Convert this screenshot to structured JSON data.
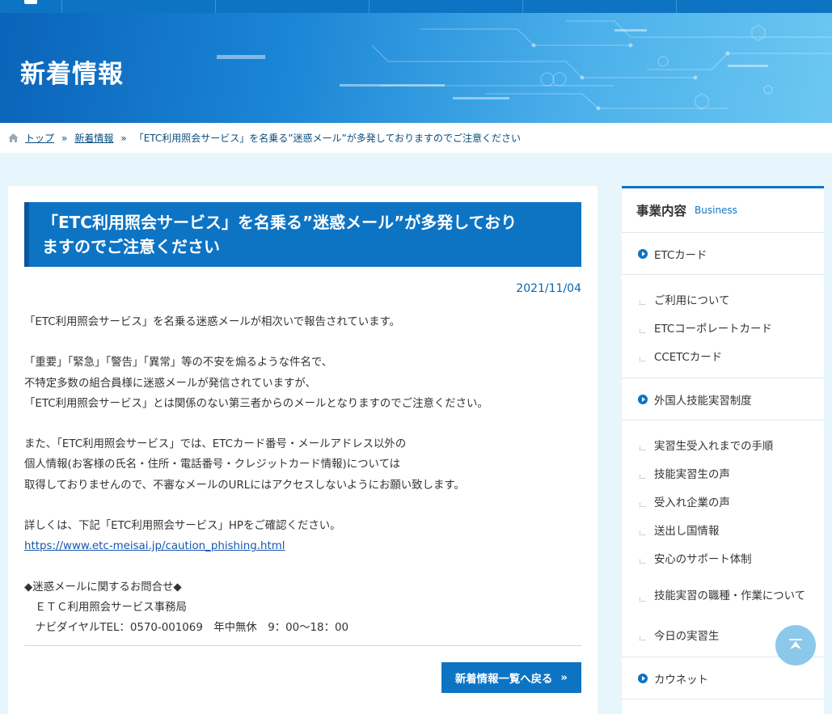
{
  "hero": {
    "title": "新着情報"
  },
  "breadcrumb": {
    "items": [
      "トップ",
      "新着情報"
    ],
    "separator": "»",
    "current": "「ETC利用照会サービス」を名乗る”迷惑メール”が多発しておりますのでご注意ください"
  },
  "article": {
    "title_line1": "「ETC利用照会サービス」を名乗る”迷惑メール”が多発しており",
    "title_line2": "ますのでご注意ください",
    "date": "2021/11/04",
    "lines": [
      "「ETC利用照会サービス」を名乗る迷惑メールが相次いで報告されています。",
      "「重要」「緊急」「警告」「異常」等の不安を煽るような件名で、",
      "不特定多数の組合員様に迷惑メールが発信されていますが、",
      "「ETC利用照会サービス」とは関係のない第三者からのメールとなりますのでご注意ください。",
      "また、「ETC利用照会サービス」では、ETCカード番号・メールアドレス以外の",
      "個人情報(お客様の氏名・住所・電話番号・クレジットカード情報)については",
      "取得しておりませんので、不審なメールのURLにはアクセスしないようにお願い致します。",
      "詳しくは、下記「ETC利用照会サービス」HPをご確認ください。",
      "https://www.etc-meisai.jp/caution_phishing.html",
      "◆迷惑メールに関するお問合せ◆",
      "　ＥＴＣ利用照会サービス事務局",
      "　ナビダイヤルTEL：0570-001069　年中無休　9：00～18：00"
    ],
    "back_label": "新着情報一覧へ戻る",
    "back_arrow": "»"
  },
  "sidebar": {
    "heading": "事業内容",
    "heading_en": "Business",
    "etc_card": "ETCカード",
    "etc_sub": [
      "ご利用について",
      "ETCコーポレートカード",
      "CCETCカード"
    ],
    "trainee": "外国人技能実習制度",
    "trainee_sub": [
      "実習生受入れまでの手順",
      "技能実習生の声",
      "受入れ企業の声",
      "送出し国情報",
      "安心のサポート体制",
      "技能実習の職種・作業について",
      "今日の実習生"
    ],
    "kaunet": "カウネット"
  },
  "colors": {
    "primary": "#0d74c4",
    "page_bg": "#e6f6fc",
    "link": "#1558b0"
  }
}
